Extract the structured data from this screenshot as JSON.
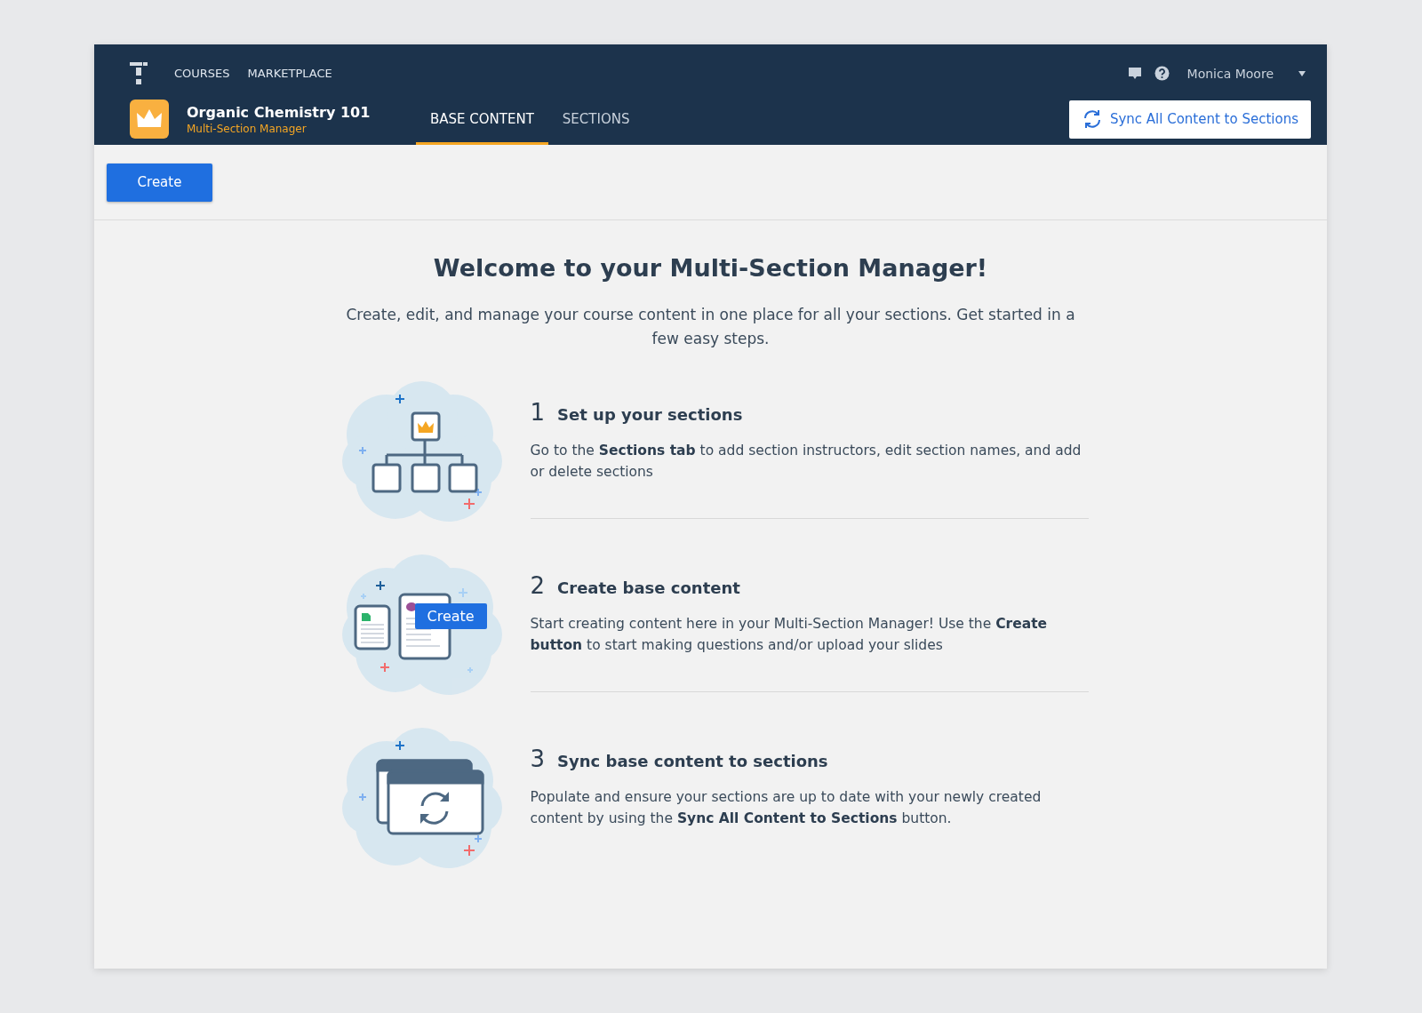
{
  "top_nav": {
    "links": [
      {
        "label": "COURSES"
      },
      {
        "label": "MARKETPLACE"
      }
    ],
    "user_name": "Monica Moore"
  },
  "course": {
    "title": "Organic Chemistry 101",
    "subtitle": "Multi-Section Manager"
  },
  "tabs": [
    {
      "label": "BASE CONTENT",
      "selected": true
    },
    {
      "label": "SECTIONS",
      "selected": false
    }
  ],
  "sync_button": "Sync All Content to Sections",
  "create_button": "Create",
  "welcome": {
    "title": "Welcome to your Multi-Section Manager!",
    "intro": "Create, edit, and manage your course content in one place for all your sections. Get started in a few easy steps."
  },
  "steps": [
    {
      "kind": "hierarchy",
      "number": "1",
      "title": "Set up your sections",
      "description": "Go to the **Sections tab** to add section instructors, edit section names, and add or delete sections"
    },
    {
      "kind": "create",
      "number": "2",
      "title": "Create base content",
      "description": "Start creating content here in your Multi-Section Manager! Use the **Create button** to start making questions and/or upload your slides",
      "illustration_label": "Create"
    },
    {
      "kind": "sync",
      "number": "3",
      "title": "Sync base content to sections",
      "description": "Populate and ensure your sections are up to date with your newly created content by using the **Sync All Content to Sections** button."
    }
  ]
}
